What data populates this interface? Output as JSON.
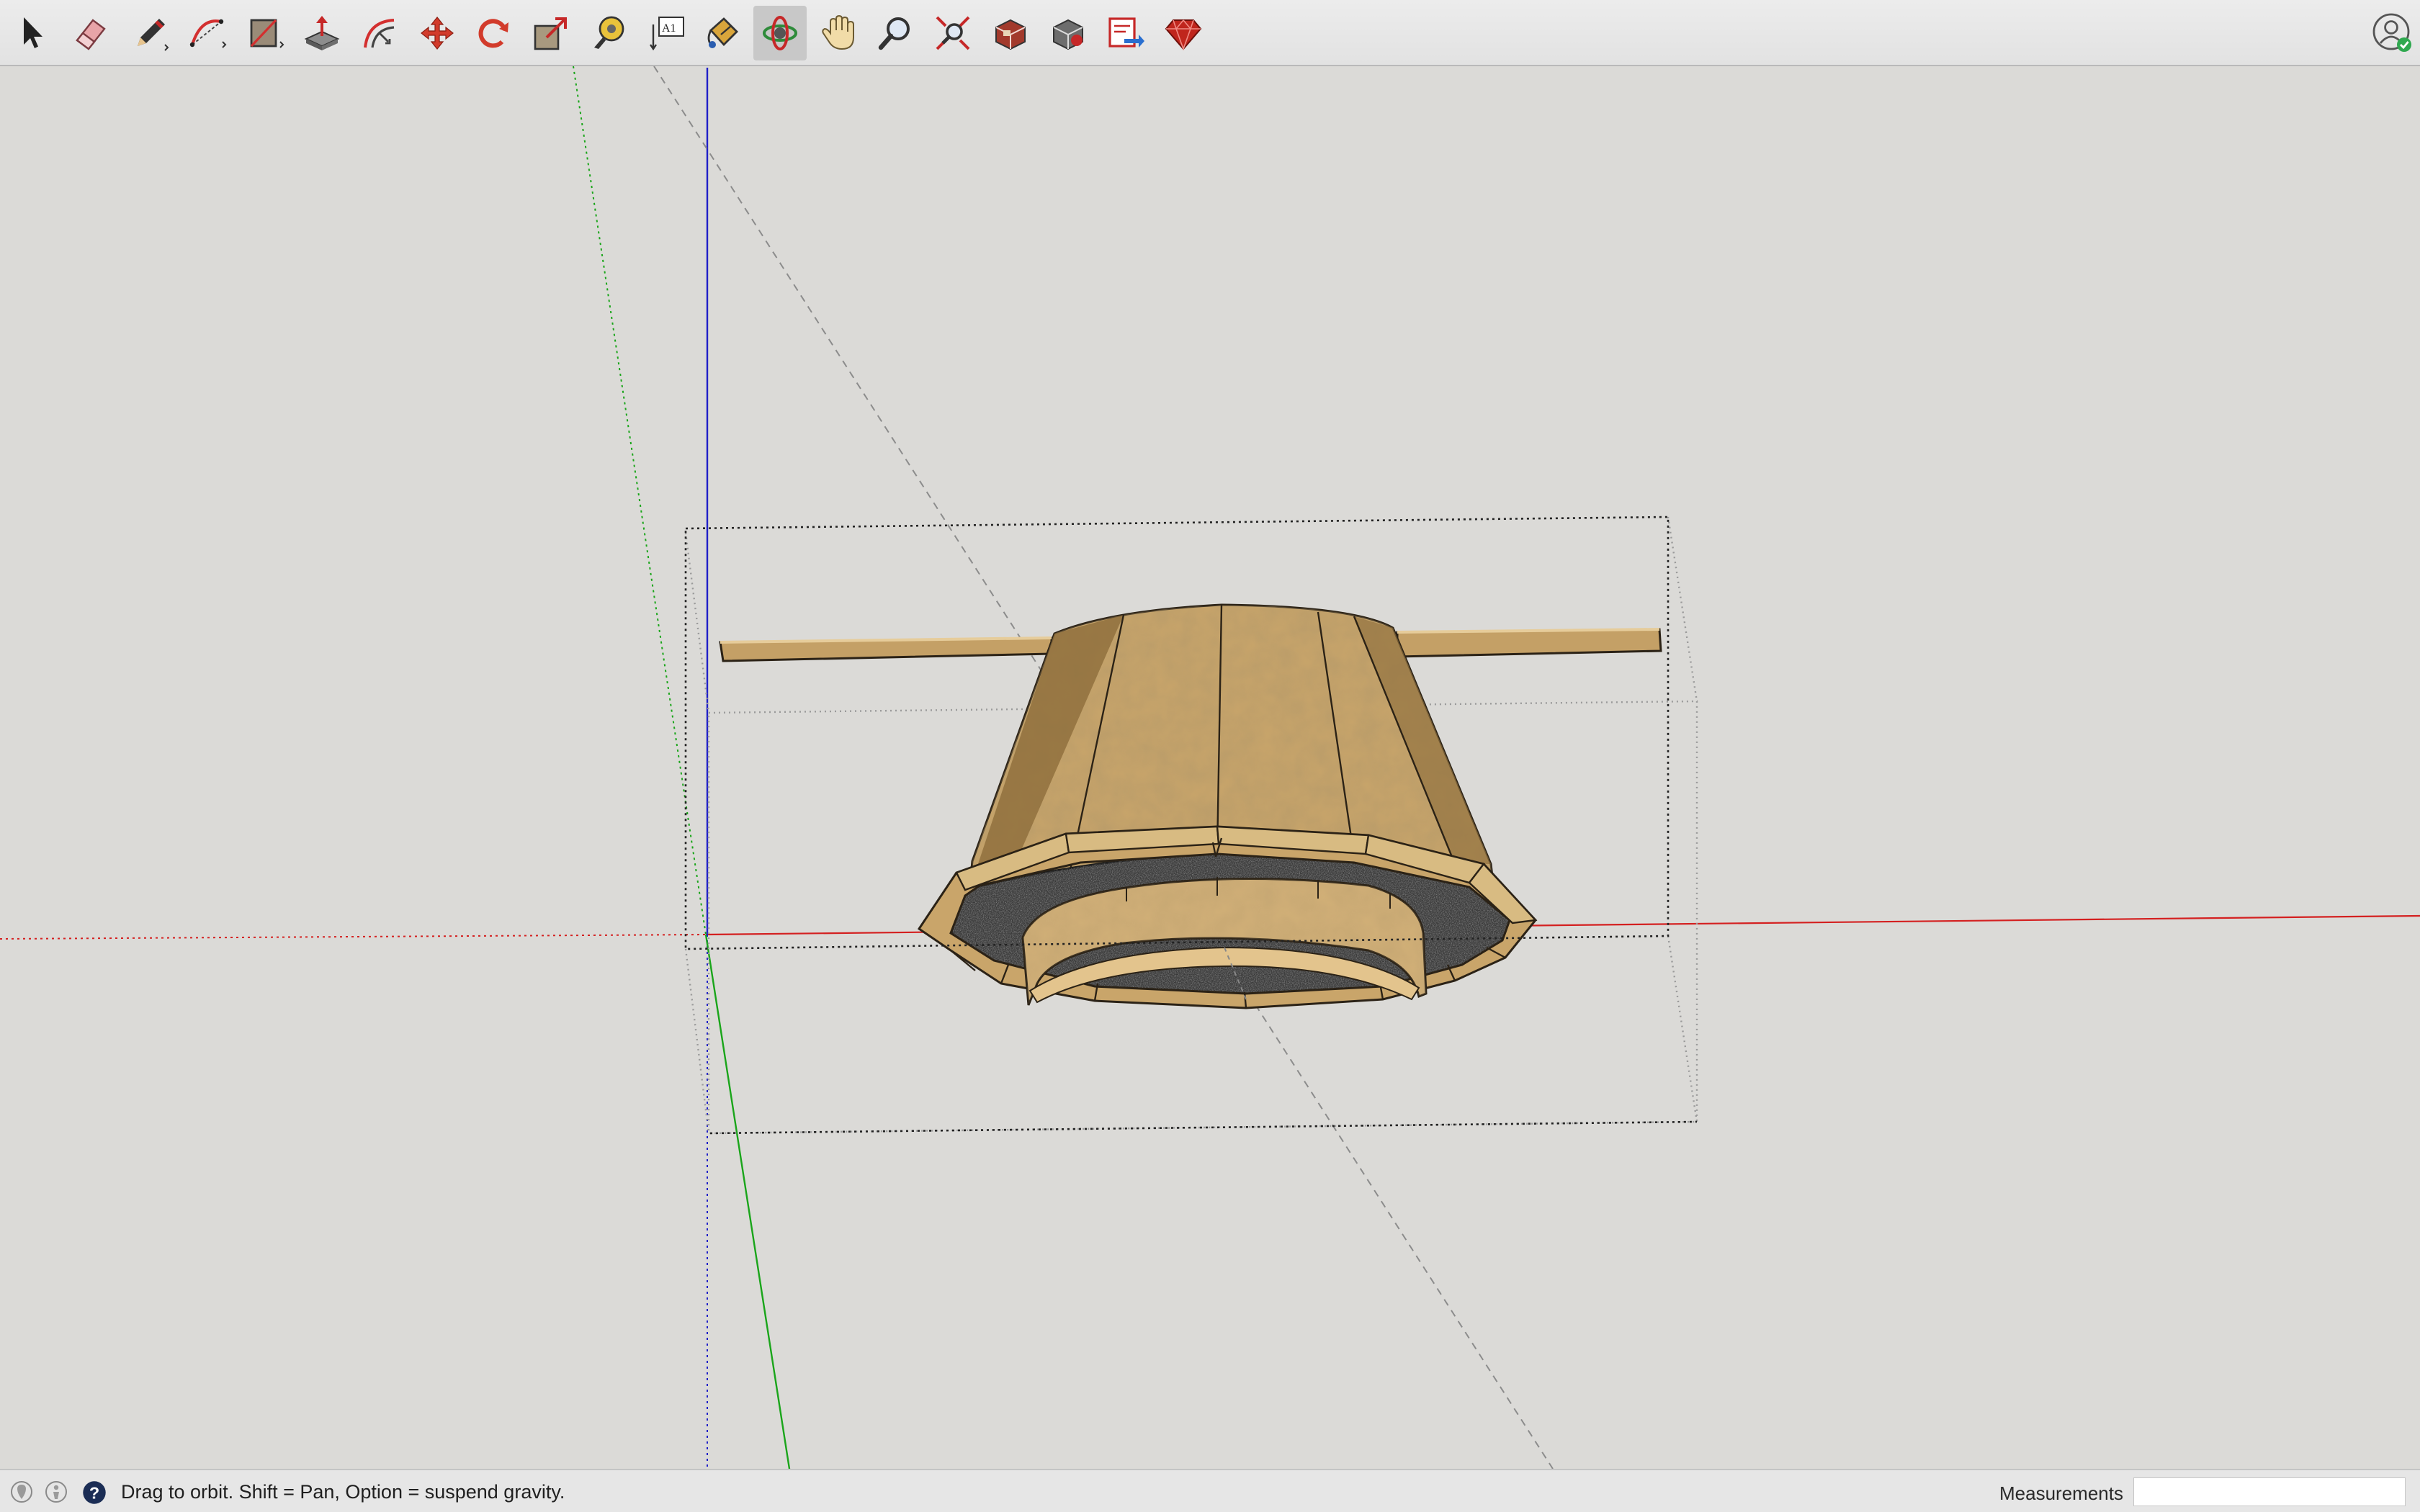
{
  "toolbar": {
    "tools": [
      {
        "name": "select-tool",
        "icon": "cursor-arrow-icon"
      },
      {
        "name": "eraser-tool",
        "icon": "eraser-icon"
      },
      {
        "name": "line-tool",
        "icon": "pencil-icon"
      },
      {
        "name": "arc-tool",
        "icon": "arc-icon"
      },
      {
        "name": "rectangle-tool",
        "icon": "rectangle-icon"
      },
      {
        "name": "push-pull-tool",
        "icon": "push-pull-icon"
      },
      {
        "name": "offset-tool",
        "icon": "offset-icon"
      },
      {
        "name": "move-tool",
        "icon": "move-arrows-icon"
      },
      {
        "name": "rotate-tool",
        "icon": "rotate-icon"
      },
      {
        "name": "scale-tool",
        "icon": "scale-icon"
      },
      {
        "name": "tape-measure-tool",
        "icon": "tape-measure-icon"
      },
      {
        "name": "text-tool",
        "icon": "text-label-icon"
      },
      {
        "name": "paint-bucket-tool",
        "icon": "paint-bucket-icon"
      },
      {
        "name": "orbit-tool",
        "icon": "orbit-icon",
        "active": true
      },
      {
        "name": "pan-tool",
        "icon": "hand-icon"
      },
      {
        "name": "zoom-tool",
        "icon": "magnifier-icon"
      },
      {
        "name": "zoom-extents-tool",
        "icon": "zoom-extents-icon"
      },
      {
        "name": "warehouse-tool",
        "icon": "3d-warehouse-icon"
      },
      {
        "name": "extension-warehouse-tool",
        "icon": "extension-warehouse-icon"
      },
      {
        "name": "send-to-layout-tool",
        "icon": "send-to-layout-icon"
      },
      {
        "name": "ruby-console-tool",
        "icon": "ruby-gem-icon"
      }
    ],
    "text_tool_glyph": "A1",
    "profile_icon": "user-profile-icon"
  },
  "status": {
    "message": "Drag to orbit. Shift = Pan, Option = suspend gravity.",
    "measurements_label": "Measurements",
    "measurements_value": ""
  },
  "colors": {
    "background": "#dbdad7",
    "x_axis": "#d42020",
    "y_axis": "#1aa51a",
    "z_axis": "#1f1fc8",
    "wood": "#c9a56a",
    "wood_dark": "#8a6a38",
    "fabric": "#3c3c3c",
    "active_tool": "#c8c8c8"
  }
}
